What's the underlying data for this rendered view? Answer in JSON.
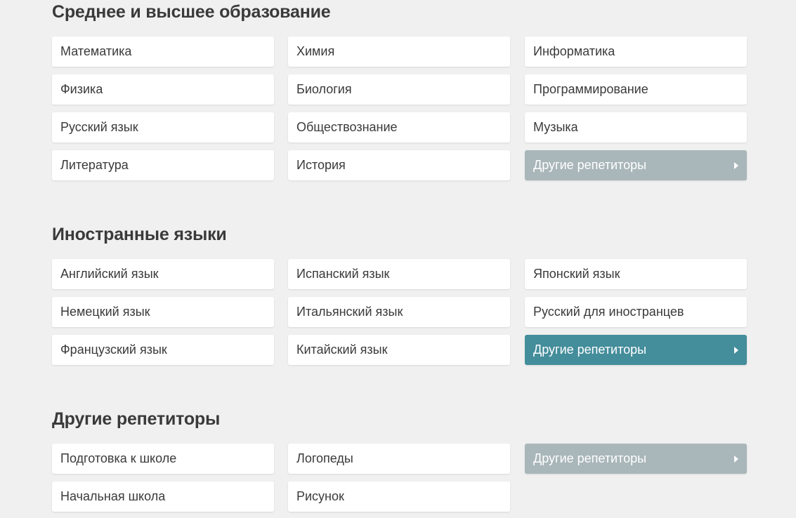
{
  "sections": [
    {
      "title": "Среднее и высшее образование",
      "subjects": [
        "Математика",
        "Химия",
        "Информатика",
        "Физика",
        "Биология",
        "Программирование",
        "Русский язык",
        "Обществознание",
        "Музыка",
        "Литература",
        "История"
      ],
      "more_label": "Другие репетиторы",
      "more_style": "dim"
    },
    {
      "title": "Иностранные языки",
      "subjects": [
        "Английский язык",
        "Испанский язык",
        "Японский язык",
        "Немецкий язык",
        "Итальянский язык",
        "Русский для иностранцев",
        "Французский язык",
        "Китайский язык"
      ],
      "more_label": "Другие репетиторы",
      "more_style": "accent"
    },
    {
      "title": "Другие репетиторы",
      "subjects": [
        "Подготовка к школе",
        "Логопеды",
        "Начальная школа",
        "Рисунок"
      ],
      "more_label": "Другие репетиторы",
      "more_style": "dim"
    }
  ],
  "colors": {
    "background": "#f0f0f0",
    "tile": "#ffffff",
    "more_dim": "#a9b6ba",
    "more_accent": "#448d9b",
    "text": "#3a3a3a"
  },
  "icons": {
    "more_arrow": "caret-right-icon"
  }
}
